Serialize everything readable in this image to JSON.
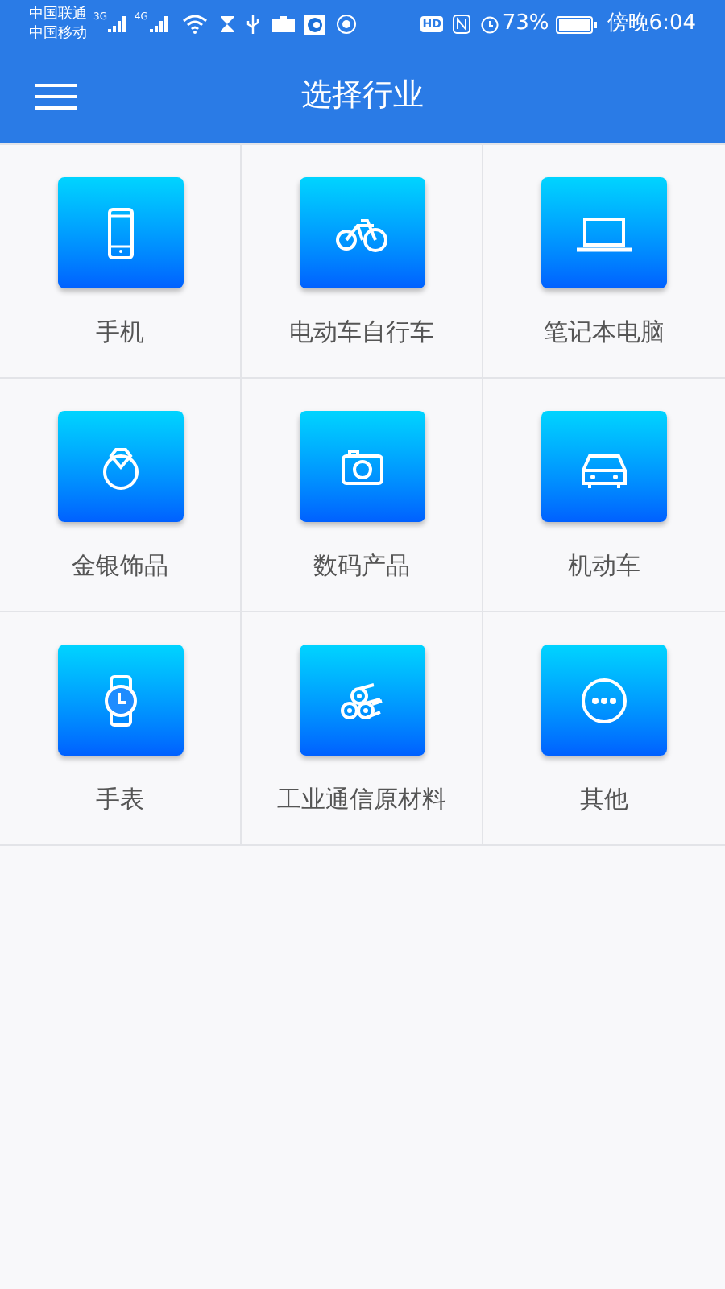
{
  "status_bar": {
    "carriers": [
      "中国联通",
      "中国移动"
    ],
    "network_1": "3G",
    "network_2": "4G",
    "hd": "HD",
    "battery": "73%",
    "time": "傍晚6:04"
  },
  "app_bar": {
    "title": "选择行业"
  },
  "industries": [
    {
      "label": "手机",
      "kind": "phone"
    },
    {
      "label": "电动车自行车",
      "kind": "bicycle"
    },
    {
      "label": "笔记本电脑",
      "kind": "laptop"
    },
    {
      "label": "金银饰品",
      "kind": "jewelry"
    },
    {
      "label": "数码产品",
      "kind": "camera"
    },
    {
      "label": "机动车",
      "kind": "car"
    },
    {
      "label": "手表",
      "kind": "watch"
    },
    {
      "label": "工业通信原材料",
      "kind": "pipes"
    },
    {
      "label": "其他",
      "kind": "more"
    }
  ]
}
